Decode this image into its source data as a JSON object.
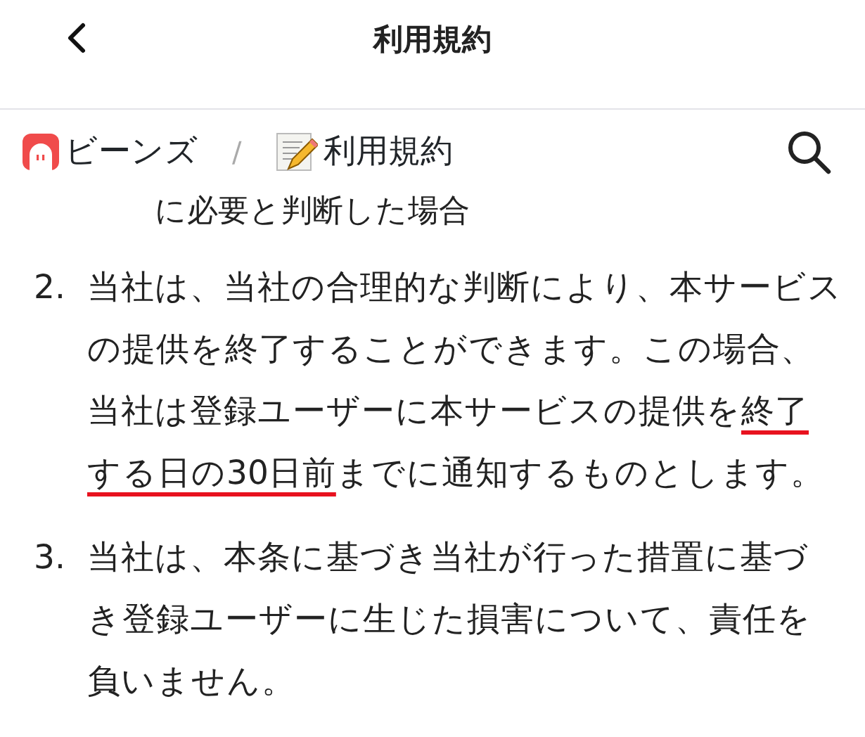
{
  "header": {
    "title": "利用規約"
  },
  "breadcrumb": [
    {
      "label": "ビーンズ"
    },
    {
      "label": "利用規約"
    }
  ],
  "breadcrumb_separator": "/",
  "clipped_line": "に必要と判断した場合",
  "items": [
    {
      "number": "2.",
      "segments": [
        {
          "text": "当社は、当社の合理的な判断により、本サービスの提供を終了することができます。この場合、当社は登録ユーザーに本サービスの提供を",
          "underline": false
        },
        {
          "text": "終了する日の30日前",
          "underline": true
        },
        {
          "text": "までに通知するものとします。",
          "underline": false
        }
      ]
    },
    {
      "number": "3.",
      "segments": [
        {
          "text": "当社は、本条に基づき当社が行った措置に基づき登録ユーザーに生じた損害について、責任を負いません。",
          "underline": false
        }
      ]
    }
  ]
}
